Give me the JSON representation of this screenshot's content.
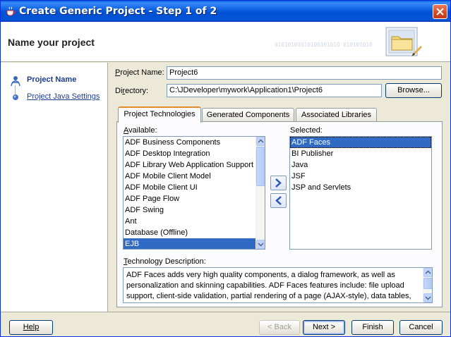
{
  "window": {
    "title": "Create Generic Project - Step 1 of 2",
    "icons": {
      "app": "coffee-cup-icon",
      "close": "close-icon"
    }
  },
  "header": {
    "title": "Name your project",
    "binary_text": "01010101010100101010  010101010",
    "graphic": "folder-icon"
  },
  "sidebar": {
    "items": [
      {
        "label": "Project Name",
        "state": "current",
        "icon": "person-icon"
      },
      {
        "label": "Project Java Settings",
        "state": "link",
        "icon": "step-dot-icon"
      }
    ]
  },
  "form": {
    "project_name": {
      "label_mnemonic": "P",
      "label_rest": "roject Name:",
      "value": "Project6"
    },
    "directory": {
      "label_pre": "Di",
      "label_mnemonic": "r",
      "label_rest": "ectory:",
      "value": "C:\\JDeveloper\\mywork\\Application1\\Project6"
    },
    "browse_label": "Browse..."
  },
  "tabs": [
    {
      "label": "Project Technologies",
      "active": true
    },
    {
      "label": "Generated Components",
      "active": false
    },
    {
      "label": "Associated Libraries",
      "active": false
    }
  ],
  "available": {
    "label_mnemonic": "A",
    "label_rest": "vailable:",
    "items": [
      "ADF Business Components",
      "ADF Desktop Integration",
      "ADF Library Web Application Support",
      "ADF Mobile Client Model",
      "ADF Mobile Client UI",
      "ADF Page Flow",
      "ADF Swing",
      "Ant",
      "Database (Offline)",
      "EJB"
    ],
    "selected_index": 9
  },
  "selected": {
    "label": "Selected:",
    "items": [
      "ADF Faces",
      "BI Publisher",
      "Java",
      "JSF",
      "JSP and Servlets"
    ],
    "selected_index": 0
  },
  "move_buttons": {
    "add": "move-right-icon",
    "remove": "move-left-icon"
  },
  "description": {
    "label_mnemonic": "T",
    "label_rest": "echnology Description:",
    "lines": [
      "ADF Faces adds very high quality components, a dialog framework, as well as",
      "personalization and skinning capabilities. ADF Faces features include: file upload",
      "support, client-side validation, partial rendering of a page (AJAX-style), data tables,"
    ]
  },
  "footer": {
    "help": "Help",
    "back": "< Back",
    "next": "Next >",
    "finish": "Finish",
    "cancel": "Cancel"
  },
  "colors": {
    "titlebar": "#0150d4",
    "selection": "#316ac5",
    "dialog_bg": "#ece9d8",
    "active_tab_accent": "#e68b2c"
  }
}
